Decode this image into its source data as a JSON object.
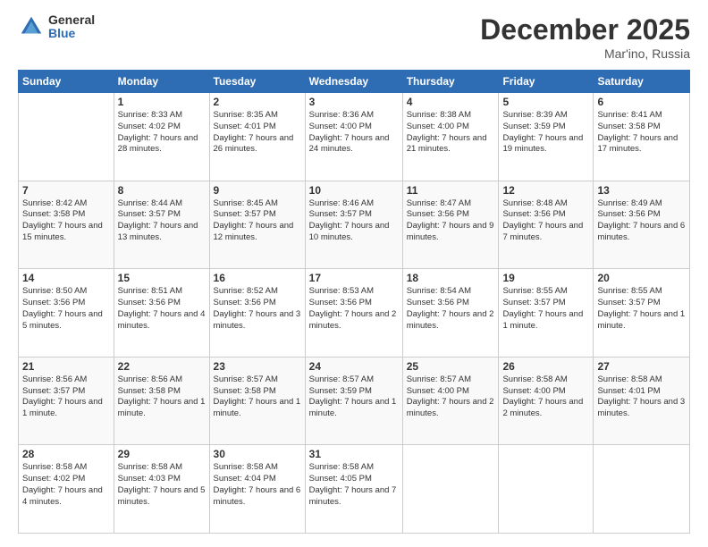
{
  "header": {
    "logo_general": "General",
    "logo_blue": "Blue",
    "month_title": "December 2025",
    "location": "Mar'ino, Russia"
  },
  "days_of_week": [
    "Sunday",
    "Monday",
    "Tuesday",
    "Wednesday",
    "Thursday",
    "Friday",
    "Saturday"
  ],
  "weeks": [
    [
      {
        "num": "",
        "sunrise": "",
        "sunset": "",
        "daylight": ""
      },
      {
        "num": "1",
        "sunrise": "Sunrise: 8:33 AM",
        "sunset": "Sunset: 4:02 PM",
        "daylight": "Daylight: 7 hours and 28 minutes."
      },
      {
        "num": "2",
        "sunrise": "Sunrise: 8:35 AM",
        "sunset": "Sunset: 4:01 PM",
        "daylight": "Daylight: 7 hours and 26 minutes."
      },
      {
        "num": "3",
        "sunrise": "Sunrise: 8:36 AM",
        "sunset": "Sunset: 4:00 PM",
        "daylight": "Daylight: 7 hours and 24 minutes."
      },
      {
        "num": "4",
        "sunrise": "Sunrise: 8:38 AM",
        "sunset": "Sunset: 4:00 PM",
        "daylight": "Daylight: 7 hours and 21 minutes."
      },
      {
        "num": "5",
        "sunrise": "Sunrise: 8:39 AM",
        "sunset": "Sunset: 3:59 PM",
        "daylight": "Daylight: 7 hours and 19 minutes."
      },
      {
        "num": "6",
        "sunrise": "Sunrise: 8:41 AM",
        "sunset": "Sunset: 3:58 PM",
        "daylight": "Daylight: 7 hours and 17 minutes."
      }
    ],
    [
      {
        "num": "7",
        "sunrise": "Sunrise: 8:42 AM",
        "sunset": "Sunset: 3:58 PM",
        "daylight": "Daylight: 7 hours and 15 minutes."
      },
      {
        "num": "8",
        "sunrise": "Sunrise: 8:44 AM",
        "sunset": "Sunset: 3:57 PM",
        "daylight": "Daylight: 7 hours and 13 minutes."
      },
      {
        "num": "9",
        "sunrise": "Sunrise: 8:45 AM",
        "sunset": "Sunset: 3:57 PM",
        "daylight": "Daylight: 7 hours and 12 minutes."
      },
      {
        "num": "10",
        "sunrise": "Sunrise: 8:46 AM",
        "sunset": "Sunset: 3:57 PM",
        "daylight": "Daylight: 7 hours and 10 minutes."
      },
      {
        "num": "11",
        "sunrise": "Sunrise: 8:47 AM",
        "sunset": "Sunset: 3:56 PM",
        "daylight": "Daylight: 7 hours and 9 minutes."
      },
      {
        "num": "12",
        "sunrise": "Sunrise: 8:48 AM",
        "sunset": "Sunset: 3:56 PM",
        "daylight": "Daylight: 7 hours and 7 minutes."
      },
      {
        "num": "13",
        "sunrise": "Sunrise: 8:49 AM",
        "sunset": "Sunset: 3:56 PM",
        "daylight": "Daylight: 7 hours and 6 minutes."
      }
    ],
    [
      {
        "num": "14",
        "sunrise": "Sunrise: 8:50 AM",
        "sunset": "Sunset: 3:56 PM",
        "daylight": "Daylight: 7 hours and 5 minutes."
      },
      {
        "num": "15",
        "sunrise": "Sunrise: 8:51 AM",
        "sunset": "Sunset: 3:56 PM",
        "daylight": "Daylight: 7 hours and 4 minutes."
      },
      {
        "num": "16",
        "sunrise": "Sunrise: 8:52 AM",
        "sunset": "Sunset: 3:56 PM",
        "daylight": "Daylight: 7 hours and 3 minutes."
      },
      {
        "num": "17",
        "sunrise": "Sunrise: 8:53 AM",
        "sunset": "Sunset: 3:56 PM",
        "daylight": "Daylight: 7 hours and 2 minutes."
      },
      {
        "num": "18",
        "sunrise": "Sunrise: 8:54 AM",
        "sunset": "Sunset: 3:56 PM",
        "daylight": "Daylight: 7 hours and 2 minutes."
      },
      {
        "num": "19",
        "sunrise": "Sunrise: 8:55 AM",
        "sunset": "Sunset: 3:57 PM",
        "daylight": "Daylight: 7 hours and 1 minute."
      },
      {
        "num": "20",
        "sunrise": "Sunrise: 8:55 AM",
        "sunset": "Sunset: 3:57 PM",
        "daylight": "Daylight: 7 hours and 1 minute."
      }
    ],
    [
      {
        "num": "21",
        "sunrise": "Sunrise: 8:56 AM",
        "sunset": "Sunset: 3:57 PM",
        "daylight": "Daylight: 7 hours and 1 minute."
      },
      {
        "num": "22",
        "sunrise": "Sunrise: 8:56 AM",
        "sunset": "Sunset: 3:58 PM",
        "daylight": "Daylight: 7 hours and 1 minute."
      },
      {
        "num": "23",
        "sunrise": "Sunrise: 8:57 AM",
        "sunset": "Sunset: 3:58 PM",
        "daylight": "Daylight: 7 hours and 1 minute."
      },
      {
        "num": "24",
        "sunrise": "Sunrise: 8:57 AM",
        "sunset": "Sunset: 3:59 PM",
        "daylight": "Daylight: 7 hours and 1 minute."
      },
      {
        "num": "25",
        "sunrise": "Sunrise: 8:57 AM",
        "sunset": "Sunset: 4:00 PM",
        "daylight": "Daylight: 7 hours and 2 minutes."
      },
      {
        "num": "26",
        "sunrise": "Sunrise: 8:58 AM",
        "sunset": "Sunset: 4:00 PM",
        "daylight": "Daylight: 7 hours and 2 minutes."
      },
      {
        "num": "27",
        "sunrise": "Sunrise: 8:58 AM",
        "sunset": "Sunset: 4:01 PM",
        "daylight": "Daylight: 7 hours and 3 minutes."
      }
    ],
    [
      {
        "num": "28",
        "sunrise": "Sunrise: 8:58 AM",
        "sunset": "Sunset: 4:02 PM",
        "daylight": "Daylight: 7 hours and 4 minutes."
      },
      {
        "num": "29",
        "sunrise": "Sunrise: 8:58 AM",
        "sunset": "Sunset: 4:03 PM",
        "daylight": "Daylight: 7 hours and 5 minutes."
      },
      {
        "num": "30",
        "sunrise": "Sunrise: 8:58 AM",
        "sunset": "Sunset: 4:04 PM",
        "daylight": "Daylight: 7 hours and 6 minutes."
      },
      {
        "num": "31",
        "sunrise": "Sunrise: 8:58 AM",
        "sunset": "Sunset: 4:05 PM",
        "daylight": "Daylight: 7 hours and 7 minutes."
      },
      {
        "num": "",
        "sunrise": "",
        "sunset": "",
        "daylight": ""
      },
      {
        "num": "",
        "sunrise": "",
        "sunset": "",
        "daylight": ""
      },
      {
        "num": "",
        "sunrise": "",
        "sunset": "",
        "daylight": ""
      }
    ]
  ]
}
